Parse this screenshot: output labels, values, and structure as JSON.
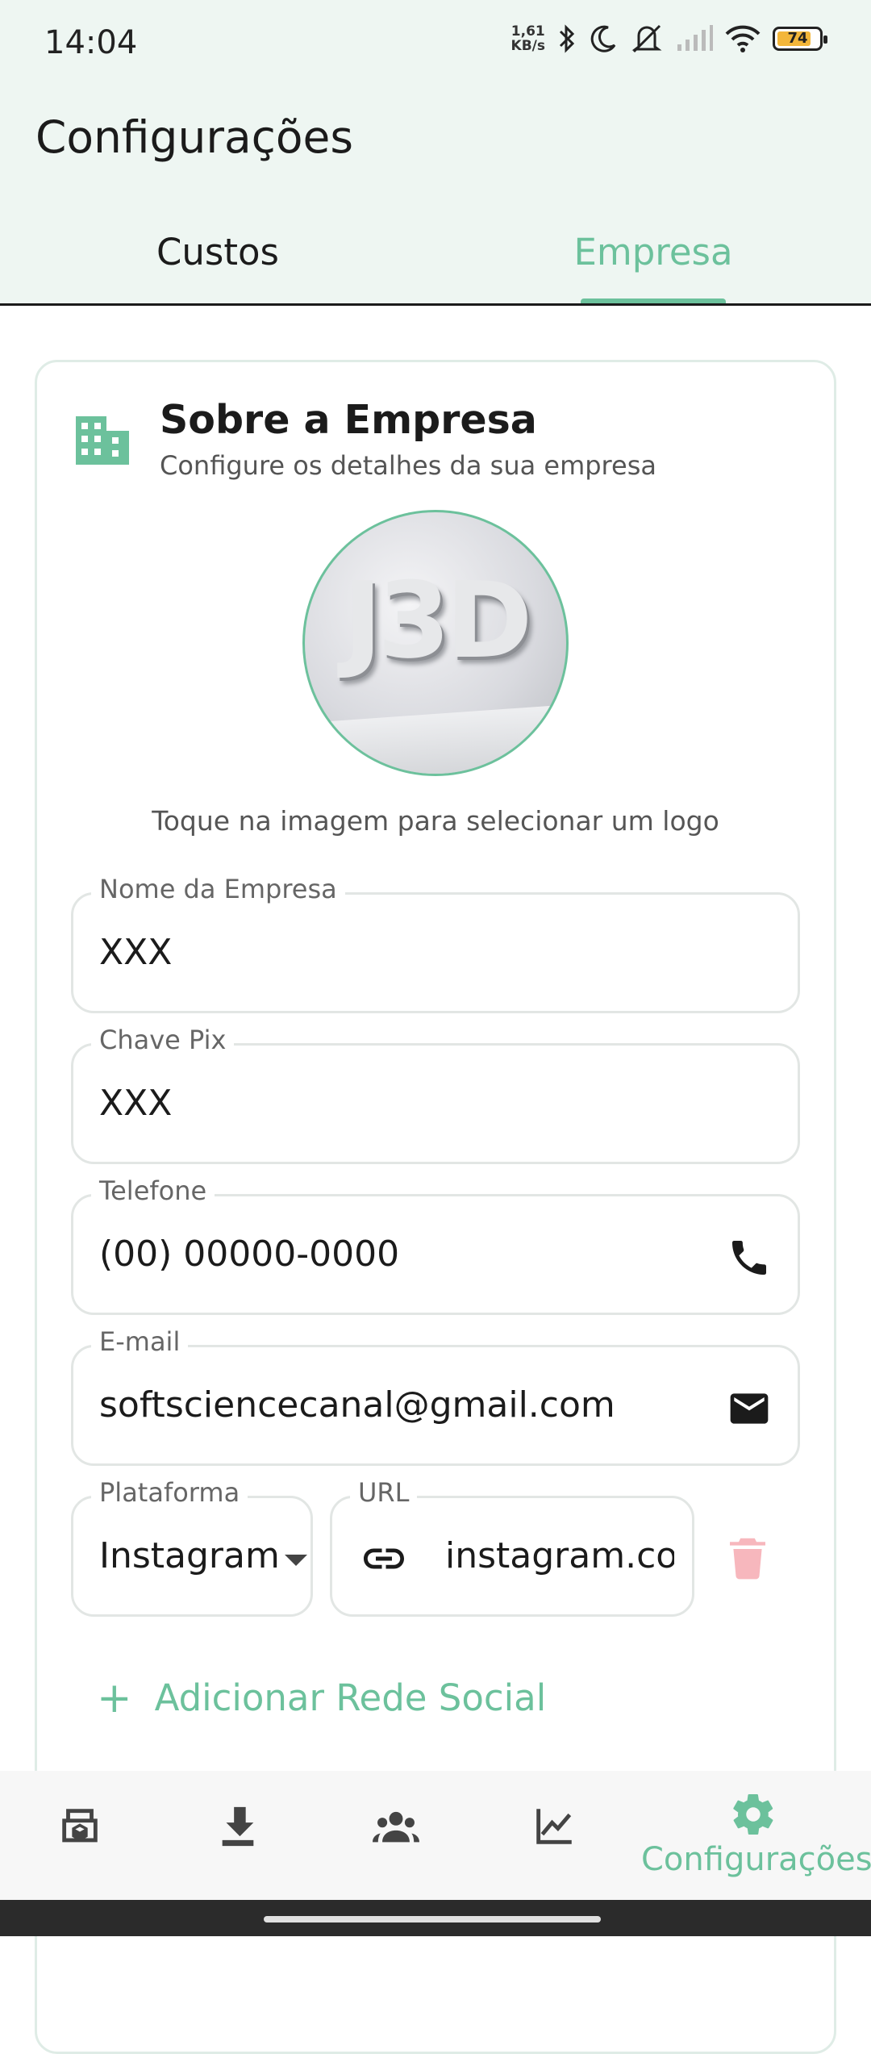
{
  "status_bar": {
    "time": "14:04",
    "net_speed_value": "1,61",
    "net_speed_unit": "KB/s",
    "battery": "74"
  },
  "header": {
    "title": "Configurações"
  },
  "tabs": [
    {
      "label": "Custos",
      "selected": false
    },
    {
      "label": "Empresa",
      "selected": true
    }
  ],
  "company": {
    "title": "Sobre a Empresa",
    "subtitle": "Configure os detalhes da sua empresa",
    "logo_text": "J3D",
    "logo_hint": "Toque na imagem para selecionar um logo",
    "fields": {
      "name": {
        "label": "Nome da Empresa",
        "value": "XXX"
      },
      "pix": {
        "label": "Chave Pix",
        "value": "XXX"
      },
      "phone": {
        "label": "Telefone",
        "value": "(00) 00000-0000"
      },
      "email": {
        "label": "E-mail",
        "value": "softsciencecanal@gmail.com"
      }
    },
    "social": {
      "platform_label": "Plataforma",
      "platform_value": "Instagram",
      "url_label": "URL",
      "url_value": "instagram.com"
    },
    "add_social_label": "Adicionar Rede Social"
  },
  "bottom_nav": {
    "items": [
      "printer",
      "download",
      "group",
      "chart",
      "settings"
    ],
    "active_label": "Configurações"
  },
  "colors": {
    "accent": "#6cc19c",
    "header_bg": "#eef6f2",
    "danger_soft": "#f7b7bd"
  }
}
